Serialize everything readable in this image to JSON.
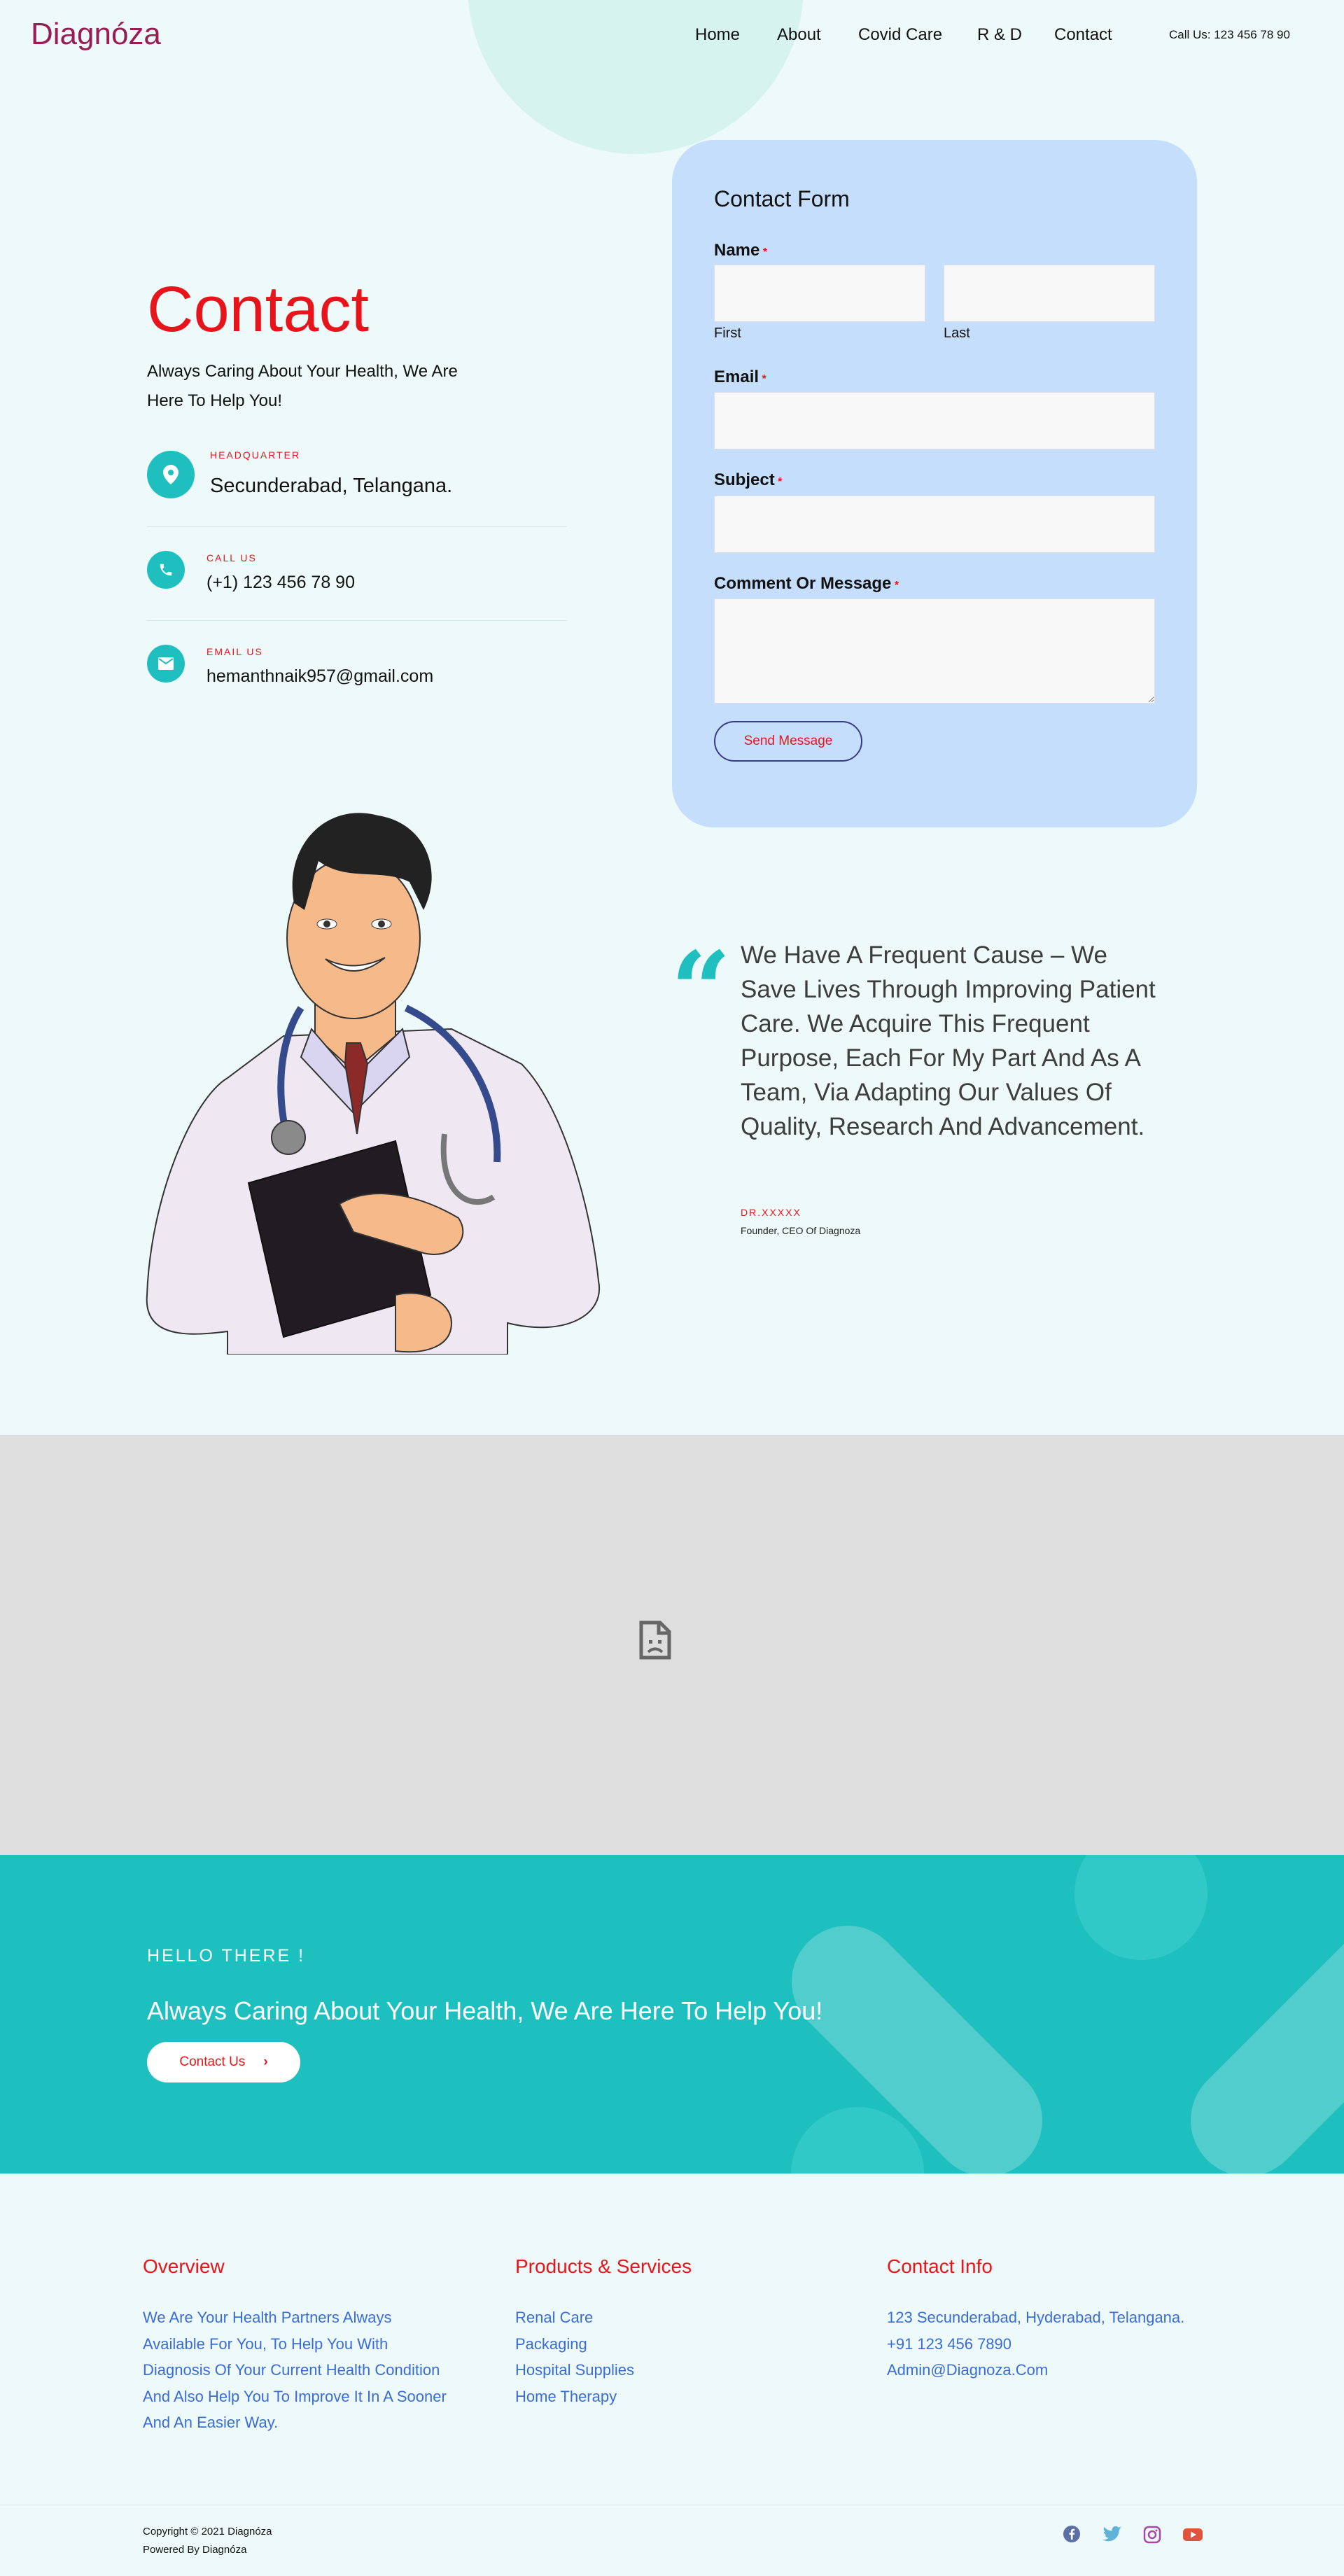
{
  "colors": {
    "brand": "#9b1b55",
    "accent_red": "#e8141b",
    "teal": "#1fbfbf",
    "form_bg": "#c5defc",
    "link_blue": "#3a6cd6"
  },
  "header": {
    "logo": "Diagnóza",
    "nav": [
      "Home",
      "About",
      "Covid Care",
      "R & D",
      "Contact"
    ],
    "call": "Call Us: 123 456 78 90"
  },
  "contact": {
    "title": "Contact",
    "subtitle": "Always Caring About Your Health, We Are Here To Help You!",
    "items": [
      {
        "icon": "map-pin-icon",
        "label": "HEADQUARTER",
        "value": "Secunderabad, Telangana."
      },
      {
        "icon": "phone-icon",
        "label": "CALL US",
        "value": "(+1) 123 456 78 90"
      },
      {
        "icon": "envelope-icon",
        "label": "EMAIL US",
        "value": "hemanthnaik957@gmail.com"
      }
    ]
  },
  "form": {
    "title": "Contact Form",
    "name_label": "Name",
    "first_label": "First",
    "last_label": "Last",
    "email_label": "Email",
    "subject_label": "Subject",
    "message_label": "Comment Or Message",
    "required_mark": "*",
    "submit": "Send Message"
  },
  "quote": {
    "text": "We Have A Frequent Cause – We Save Lives Through Improving Patient Care. We Acquire This Frequent Purpose, Each For My Part And As A Team, Via Adapting Our Values Of Quality, Research And Advancement.",
    "author": "DR.XXXXX",
    "role": "Founder, CEO Of Diagnoza"
  },
  "map": {
    "icon": "broken-document-icon"
  },
  "cta": {
    "hello": "HELLO THERE !",
    "text": "Always Caring About Your Health, We Are Here To Help You!",
    "button": "Contact Us"
  },
  "footer": {
    "overview": {
      "title": "Overview",
      "text": [
        "We  Are Your Health Partners Always",
        "Available For You, To Help You With",
        "Diagnosis Of Your Current Health Condition",
        "And Also Help You To Improve It In A Sooner",
        "And An Easier Way."
      ]
    },
    "products": {
      "title": "Products & Services",
      "items": [
        "Renal Care",
        "Packaging",
        "Hospital Supplies",
        "Home Therapy"
      ]
    },
    "contact": {
      "title": "Contact Info",
      "items": [
        "123 Secunderabad, Hyderabad, Telangana.",
        "+91 123 456 7890",
        "Admin@Diagnoza.Com"
      ]
    },
    "copyright": "Copyright © 2021 Diagnóza",
    "powered": "Powered By Diagnóza",
    "social": [
      "facebook-icon",
      "twitter-icon",
      "instagram-icon",
      "youtube-icon"
    ]
  }
}
